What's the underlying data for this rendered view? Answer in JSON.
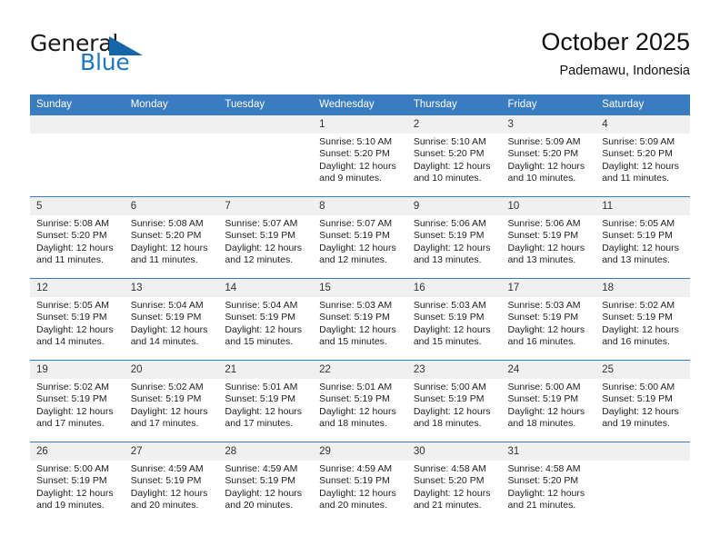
{
  "brand": {
    "name_part1": "General",
    "name_part2": "Blue",
    "triangle_color": "#1565a8",
    "blue_text_color": "#1d76c4"
  },
  "header": {
    "title": "October 2025",
    "subtitle": "Pademawu, Indonesia"
  },
  "theme": {
    "header_row_bg": "#3a7cc0",
    "daynum_bg": "#f0f0f0",
    "row_divider": "#3a7cc0",
    "page_bg": "#ffffff"
  },
  "weekdays": [
    "Sunday",
    "Monday",
    "Tuesday",
    "Wednesday",
    "Thursday",
    "Friday",
    "Saturday"
  ],
  "weeks": [
    [
      {
        "day": "",
        "lines": []
      },
      {
        "day": "",
        "lines": []
      },
      {
        "day": "",
        "lines": []
      },
      {
        "day": "1",
        "lines": [
          "Sunrise: 5:10 AM",
          "Sunset: 5:20 PM",
          "Daylight: 12 hours",
          "and 9 minutes."
        ]
      },
      {
        "day": "2",
        "lines": [
          "Sunrise: 5:10 AM",
          "Sunset: 5:20 PM",
          "Daylight: 12 hours",
          "and 10 minutes."
        ]
      },
      {
        "day": "3",
        "lines": [
          "Sunrise: 5:09 AM",
          "Sunset: 5:20 PM",
          "Daylight: 12 hours",
          "and 10 minutes."
        ]
      },
      {
        "day": "4",
        "lines": [
          "Sunrise: 5:09 AM",
          "Sunset: 5:20 PM",
          "Daylight: 12 hours",
          "and 11 minutes."
        ]
      }
    ],
    [
      {
        "day": "5",
        "lines": [
          "Sunrise: 5:08 AM",
          "Sunset: 5:20 PM",
          "Daylight: 12 hours",
          "and 11 minutes."
        ]
      },
      {
        "day": "6",
        "lines": [
          "Sunrise: 5:08 AM",
          "Sunset: 5:20 PM",
          "Daylight: 12 hours",
          "and 11 minutes."
        ]
      },
      {
        "day": "7",
        "lines": [
          "Sunrise: 5:07 AM",
          "Sunset: 5:19 PM",
          "Daylight: 12 hours",
          "and 12 minutes."
        ]
      },
      {
        "day": "8",
        "lines": [
          "Sunrise: 5:07 AM",
          "Sunset: 5:19 PM",
          "Daylight: 12 hours",
          "and 12 minutes."
        ]
      },
      {
        "day": "9",
        "lines": [
          "Sunrise: 5:06 AM",
          "Sunset: 5:19 PM",
          "Daylight: 12 hours",
          "and 13 minutes."
        ]
      },
      {
        "day": "10",
        "lines": [
          "Sunrise: 5:06 AM",
          "Sunset: 5:19 PM",
          "Daylight: 12 hours",
          "and 13 minutes."
        ]
      },
      {
        "day": "11",
        "lines": [
          "Sunrise: 5:05 AM",
          "Sunset: 5:19 PM",
          "Daylight: 12 hours",
          "and 13 minutes."
        ]
      }
    ],
    [
      {
        "day": "12",
        "lines": [
          "Sunrise: 5:05 AM",
          "Sunset: 5:19 PM",
          "Daylight: 12 hours",
          "and 14 minutes."
        ]
      },
      {
        "day": "13",
        "lines": [
          "Sunrise: 5:04 AM",
          "Sunset: 5:19 PM",
          "Daylight: 12 hours",
          "and 14 minutes."
        ]
      },
      {
        "day": "14",
        "lines": [
          "Sunrise: 5:04 AM",
          "Sunset: 5:19 PM",
          "Daylight: 12 hours",
          "and 15 minutes."
        ]
      },
      {
        "day": "15",
        "lines": [
          "Sunrise: 5:03 AM",
          "Sunset: 5:19 PM",
          "Daylight: 12 hours",
          "and 15 minutes."
        ]
      },
      {
        "day": "16",
        "lines": [
          "Sunrise: 5:03 AM",
          "Sunset: 5:19 PM",
          "Daylight: 12 hours",
          "and 15 minutes."
        ]
      },
      {
        "day": "17",
        "lines": [
          "Sunrise: 5:03 AM",
          "Sunset: 5:19 PM",
          "Daylight: 12 hours",
          "and 16 minutes."
        ]
      },
      {
        "day": "18",
        "lines": [
          "Sunrise: 5:02 AM",
          "Sunset: 5:19 PM",
          "Daylight: 12 hours",
          "and 16 minutes."
        ]
      }
    ],
    [
      {
        "day": "19",
        "lines": [
          "Sunrise: 5:02 AM",
          "Sunset: 5:19 PM",
          "Daylight: 12 hours",
          "and 17 minutes."
        ]
      },
      {
        "day": "20",
        "lines": [
          "Sunrise: 5:02 AM",
          "Sunset: 5:19 PM",
          "Daylight: 12 hours",
          "and 17 minutes."
        ]
      },
      {
        "day": "21",
        "lines": [
          "Sunrise: 5:01 AM",
          "Sunset: 5:19 PM",
          "Daylight: 12 hours",
          "and 17 minutes."
        ]
      },
      {
        "day": "22",
        "lines": [
          "Sunrise: 5:01 AM",
          "Sunset: 5:19 PM",
          "Daylight: 12 hours",
          "and 18 minutes."
        ]
      },
      {
        "day": "23",
        "lines": [
          "Sunrise: 5:00 AM",
          "Sunset: 5:19 PM",
          "Daylight: 12 hours",
          "and 18 minutes."
        ]
      },
      {
        "day": "24",
        "lines": [
          "Sunrise: 5:00 AM",
          "Sunset: 5:19 PM",
          "Daylight: 12 hours",
          "and 18 minutes."
        ]
      },
      {
        "day": "25",
        "lines": [
          "Sunrise: 5:00 AM",
          "Sunset: 5:19 PM",
          "Daylight: 12 hours",
          "and 19 minutes."
        ]
      }
    ],
    [
      {
        "day": "26",
        "lines": [
          "Sunrise: 5:00 AM",
          "Sunset: 5:19 PM",
          "Daylight: 12 hours",
          "and 19 minutes."
        ]
      },
      {
        "day": "27",
        "lines": [
          "Sunrise: 4:59 AM",
          "Sunset: 5:19 PM",
          "Daylight: 12 hours",
          "and 20 minutes."
        ]
      },
      {
        "day": "28",
        "lines": [
          "Sunrise: 4:59 AM",
          "Sunset: 5:19 PM",
          "Daylight: 12 hours",
          "and 20 minutes."
        ]
      },
      {
        "day": "29",
        "lines": [
          "Sunrise: 4:59 AM",
          "Sunset: 5:19 PM",
          "Daylight: 12 hours",
          "and 20 minutes."
        ]
      },
      {
        "day": "30",
        "lines": [
          "Sunrise: 4:58 AM",
          "Sunset: 5:20 PM",
          "Daylight: 12 hours",
          "and 21 minutes."
        ]
      },
      {
        "day": "31",
        "lines": [
          "Sunrise: 4:58 AM",
          "Sunset: 5:20 PM",
          "Daylight: 12 hours",
          "and 21 minutes."
        ]
      },
      {
        "day": "",
        "lines": []
      }
    ]
  ]
}
